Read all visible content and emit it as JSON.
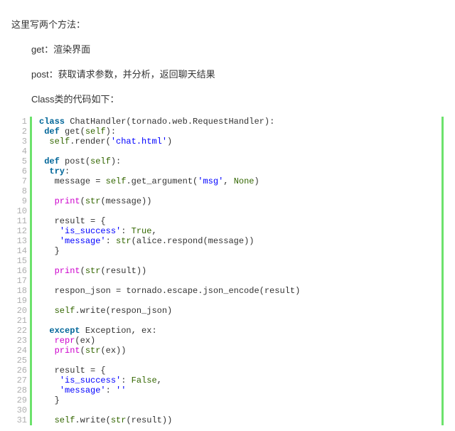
{
  "intro": {
    "line1": "这里写两个方法：",
    "line2": "get：渲染界面",
    "line3": "post：获取请求参数，并分析，返回聊天结果",
    "line4": "Class类的代码如下："
  },
  "code": {
    "line_count": 31,
    "tokens": {
      "l1_kw_class": "class",
      "l1_name": " ChatHandler(tornado.web.RequestHandler):",
      "l2_kw_def": "def",
      "l2_sig_a": " get(",
      "l2_self": "self",
      "l2_sig_b": "):",
      "l3_self": "self",
      "l3_dot_render": ".render(",
      "l3_str": "'chat.html'",
      "l3_close": ")",
      "l5_kw_def": "def",
      "l5_sig_a": " post(",
      "l5_self": "self",
      "l5_sig_b": "):",
      "l6_try": "try",
      "l6_colon": ":",
      "l7_msg": "message = ",
      "l7_self": "self",
      "l7_getarg": ".get_argument(",
      "l7_str": "'msg'",
      "l7_comma": ", ",
      "l7_none": "None",
      "l7_close": ")",
      "l9_print": "print",
      "l9_open": "(",
      "l9_str": "str",
      "l9_open2": "(message))",
      "l11_res": "result = {",
      "l12_key": "'is_success'",
      "l12_rest": ": ",
      "l12_true": "True",
      "l12_comma": ",",
      "l13_key": "'message'",
      "l13_colon": ": ",
      "l13_str": "str",
      "l13_rest": "(alice.respond(message))",
      "l14_close": "}",
      "l16_print": "print",
      "l16_open": "(",
      "l16_str": "str",
      "l16_rest": "(result))",
      "l18_rj": "respon_json = tornado.escape.json_encode(result)",
      "l20_self": "self",
      "l20_write": ".write(respon_json)",
      "l22_except": "except",
      "l22_rest": " Exception, ex:",
      "l23_repr": "repr",
      "l23_rest": "(ex)",
      "l24_print": "print",
      "l24_open": "(",
      "l24_str": "str",
      "l24_rest": "(ex))",
      "l26_res": "result = {",
      "l27_key": "'is_success'",
      "l27_colon": ": ",
      "l27_false": "False",
      "l27_comma": ",",
      "l28_key": "'message'",
      "l28_colon": ": ",
      "l28_val": "''",
      "l29_close": "}",
      "l31_self": "self",
      "l31_write": ".write(",
      "l31_str": "str",
      "l31_rest": "(result))"
    }
  }
}
